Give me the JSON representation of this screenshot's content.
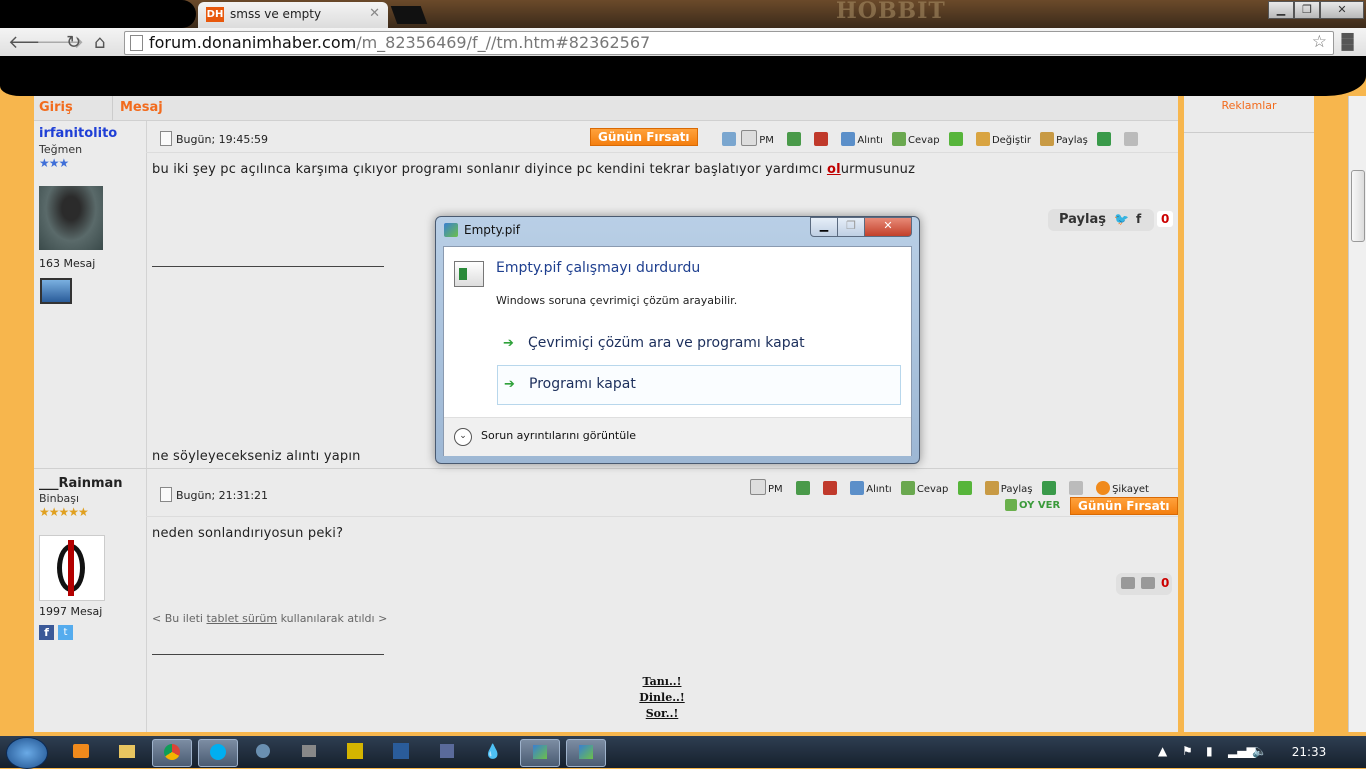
{
  "browser": {
    "tab_title": "smss ve empty",
    "tab_favicon": "DH",
    "url_host": "forum.donanimhaber.com",
    "url_path": "/m_82356469/f_//tm.htm#82362567",
    "theme_text": "HOBBIT"
  },
  "forum": {
    "header_left": "Giriş",
    "header_right": "Mesaj",
    "ads_label": "Reklamlar",
    "deal_button": "Günün Fırsatı",
    "actions": {
      "pm": "PM",
      "quote": "Alıntı",
      "reply": "Cevap",
      "edit": "Değiştir",
      "share": "Paylaş",
      "report": "Şikayet",
      "vote": "OY VER"
    },
    "posts": [
      {
        "username": "irfanitolito",
        "rank": "Teğmen",
        "stars": "★★★",
        "msg_count": "163 Mesaj",
        "date": "Bugün; 19:45:59",
        "text": "bu iki şey pc açılınca karşıma çıkıyor programı sonlanır diyince pc kendini tekrar başlatıyor yardımcı ",
        "text_link": "ol",
        "text_tail": "urmusunuz",
        "share_label": "Paylaş",
        "likes": "0",
        "footer_text": "ne söyleyecekseniz alıntı yapın"
      },
      {
        "username": "___Rainman",
        "rank": "Binbaşı",
        "stars": "★★★★★",
        "msg_count": "1997 Mesaj",
        "date": "Bugün; 21:31:21",
        "text": "neden sonlandırıyosun peki?",
        "likes": "0",
        "tablet_prefix": "< Bu ileti ",
        "tablet_link": "tablet sürüm",
        "tablet_suffix": " kullanılarak atıldı >",
        "sig_lines": [
          "Tanı..!",
          "Dinle..!",
          "Sor..!"
        ]
      }
    ]
  },
  "dialog": {
    "title": "Empty.pif",
    "heading": "Empty.pif çalışmayı durdurdu",
    "subtext": "Windows soruna çevrimiçi çözüm arayabilir.",
    "option1": "Çevrimiçi çözüm ara ve programı kapat",
    "option2": "Programı kapat",
    "details": "Sorun ayrıntılarını görüntüle"
  },
  "taskbar": {
    "clock": "21:33",
    "apps": [
      "media-player",
      "explorer",
      "chrome",
      "skype",
      "app",
      "app2",
      "fireworks",
      "photoshop",
      "app3",
      "app4",
      "empty-pif-1",
      "empty-pif-2"
    ]
  },
  "colors": {
    "accent": "#f26b1d",
    "username_blue": "#1f3fd6",
    "link_red": "#c00000",
    "dialog_heading": "#1e3f8f"
  }
}
